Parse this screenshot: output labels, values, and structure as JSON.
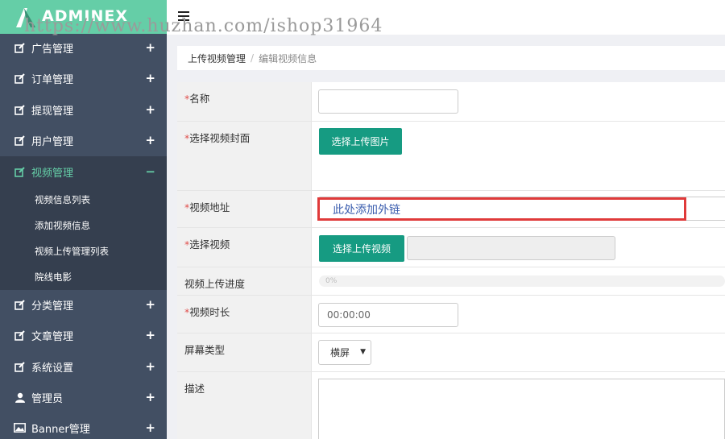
{
  "app": {
    "logo_text": "ADMINEX"
  },
  "watermark": "https://www.huzhan.com/ishop31964",
  "sidebar": {
    "items": [
      {
        "label": "广告管理",
        "sign": "+",
        "icon": "edit-icon"
      },
      {
        "label": "订单管理",
        "sign": "+",
        "icon": "edit-icon"
      },
      {
        "label": "提现管理",
        "sign": "+",
        "icon": "edit-icon"
      },
      {
        "label": "用户管理",
        "sign": "+",
        "icon": "edit-icon"
      },
      {
        "label": "视频管理",
        "sign": "−",
        "icon": "edit-icon"
      },
      {
        "label": "分类管理",
        "sign": "+",
        "icon": "edit-icon"
      },
      {
        "label": "文章管理",
        "sign": "+",
        "icon": "edit-icon"
      },
      {
        "label": "系统设置",
        "sign": "+",
        "icon": "edit-icon"
      },
      {
        "label": "管理员",
        "sign": "+",
        "icon": "user-icon"
      },
      {
        "label": "Banner管理",
        "sign": "+",
        "icon": "image-icon"
      }
    ],
    "subitems": [
      {
        "label": "视频信息列表"
      },
      {
        "label": "添加视频信息"
      },
      {
        "label": "视频上传管理列表"
      },
      {
        "label": "院线电影"
      }
    ]
  },
  "breadcrumb": {
    "parent": "上传视频管理",
    "separator": "/",
    "current": "编辑视频信息"
  },
  "form": {
    "name": {
      "label": "名称",
      "required": "*",
      "value": ""
    },
    "cover": {
      "label": "选择视频封面",
      "required": "*",
      "button": "选择上传图片"
    },
    "address": {
      "label": "视频地址",
      "required": "*",
      "annotation": "此处添加外链"
    },
    "video": {
      "label": "选择视频",
      "required": "*",
      "button": "选择上传视频"
    },
    "progress": {
      "label": "视频上传进度",
      "value_text": "0%",
      "value": 0
    },
    "duration": {
      "label": "视频时长",
      "required": "*",
      "value": "00:00:00"
    },
    "screen": {
      "label": "屏幕类型",
      "selected": "横屏"
    },
    "description": {
      "label": "描述"
    }
  },
  "colors": {
    "sidebar": "#424f63",
    "accent": "#65cea7",
    "button": "#169b82",
    "highlight": "#e03a3a"
  }
}
